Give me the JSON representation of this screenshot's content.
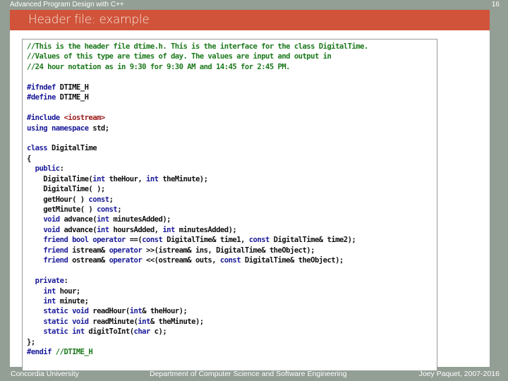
{
  "header": {
    "course_title": "Advanced Program Design with C++",
    "slide_number": "16",
    "slide_title": "Header file: example"
  },
  "colors": {
    "frame": "#939e95",
    "header_band": "#d0533a",
    "comment": "#1c7a1c",
    "keyword": "#1a1a9a",
    "string": "#9a1a1a"
  },
  "code": {
    "lines": [
      [
        {
          "t": "//This is the header file dtime.h. This is the interface for the class DigitalTime.",
          "c": "cm"
        }
      ],
      [
        {
          "t": "//Values of this type are times of day. The values are input and output in",
          "c": "cm"
        }
      ],
      [
        {
          "t": "//24 hour notation as in 9:30 for 9:30 AM and 14:45 for 2:45 PM.",
          "c": "cm"
        }
      ],
      [],
      [
        {
          "t": "#ifndef",
          "c": "pp"
        },
        {
          "t": " DTIME_H",
          "c": ""
        }
      ],
      [
        {
          "t": "#define",
          "c": "pp"
        },
        {
          "t": " DTIME_H",
          "c": ""
        }
      ],
      [],
      [
        {
          "t": "#include",
          "c": "pp"
        },
        {
          "t": " ",
          "c": ""
        },
        {
          "t": "<iostream>",
          "c": "st"
        }
      ],
      [
        {
          "t": "using",
          "c": "kw"
        },
        {
          "t": " ",
          "c": ""
        },
        {
          "t": "namespace",
          "c": "kw"
        },
        {
          "t": " std;",
          "c": ""
        }
      ],
      [],
      [
        {
          "t": "class",
          "c": "kw"
        },
        {
          "t": " DigitalTime",
          "c": ""
        }
      ],
      [
        {
          "t": "{",
          "c": ""
        }
      ],
      [
        {
          "t": "  ",
          "c": ""
        },
        {
          "t": "public",
          "c": "kw"
        },
        {
          "t": ":",
          "c": ""
        }
      ],
      [
        {
          "t": "    DigitalTime(",
          "c": ""
        },
        {
          "t": "int",
          "c": "kw"
        },
        {
          "t": " theHour, ",
          "c": ""
        },
        {
          "t": "int",
          "c": "kw"
        },
        {
          "t": " theMinute);",
          "c": ""
        }
      ],
      [
        {
          "t": "    DigitalTime( );",
          "c": ""
        }
      ],
      [
        {
          "t": "    getHour( ) ",
          "c": ""
        },
        {
          "t": "const",
          "c": "kw"
        },
        {
          "t": ";",
          "c": ""
        }
      ],
      [
        {
          "t": "    getMinute( ) ",
          "c": ""
        },
        {
          "t": "const",
          "c": "kw"
        },
        {
          "t": ";",
          "c": ""
        }
      ],
      [
        {
          "t": "    ",
          "c": ""
        },
        {
          "t": "void",
          "c": "kw"
        },
        {
          "t": " advance(",
          "c": ""
        },
        {
          "t": "int",
          "c": "kw"
        },
        {
          "t": " minutesAdded);",
          "c": ""
        }
      ],
      [
        {
          "t": "    ",
          "c": ""
        },
        {
          "t": "void",
          "c": "kw"
        },
        {
          "t": " advance(",
          "c": ""
        },
        {
          "t": "int",
          "c": "kw"
        },
        {
          "t": " hoursAdded, ",
          "c": ""
        },
        {
          "t": "int",
          "c": "kw"
        },
        {
          "t": " minutesAdded);",
          "c": ""
        }
      ],
      [
        {
          "t": "    ",
          "c": ""
        },
        {
          "t": "friend",
          "c": "kw"
        },
        {
          "t": " ",
          "c": ""
        },
        {
          "t": "bool",
          "c": "kw"
        },
        {
          "t": " ",
          "c": ""
        },
        {
          "t": "operator",
          "c": "kw"
        },
        {
          "t": " ==(",
          "c": ""
        },
        {
          "t": "const",
          "c": "kw"
        },
        {
          "t": " DigitalTime& time1, ",
          "c": ""
        },
        {
          "t": "const",
          "c": "kw"
        },
        {
          "t": " DigitalTime& time2);",
          "c": ""
        }
      ],
      [
        {
          "t": "    ",
          "c": ""
        },
        {
          "t": "friend",
          "c": "kw"
        },
        {
          "t": " istream& ",
          "c": ""
        },
        {
          "t": "operator",
          "c": "kw"
        },
        {
          "t": " >>(istream& ins, DigitalTime& theObject);",
          "c": ""
        }
      ],
      [
        {
          "t": "    ",
          "c": ""
        },
        {
          "t": "friend",
          "c": "kw"
        },
        {
          "t": " ostream& ",
          "c": ""
        },
        {
          "t": "operator",
          "c": "kw"
        },
        {
          "t": " <<(ostream& outs, ",
          "c": ""
        },
        {
          "t": "const",
          "c": "kw"
        },
        {
          "t": " DigitalTime& theObject);",
          "c": ""
        }
      ],
      [],
      [
        {
          "t": "  ",
          "c": ""
        },
        {
          "t": "private",
          "c": "kw"
        },
        {
          "t": ":",
          "c": ""
        }
      ],
      [
        {
          "t": "    ",
          "c": ""
        },
        {
          "t": "int",
          "c": "kw"
        },
        {
          "t": " hour;",
          "c": ""
        }
      ],
      [
        {
          "t": "    ",
          "c": ""
        },
        {
          "t": "int",
          "c": "kw"
        },
        {
          "t": " minute;",
          "c": ""
        }
      ],
      [
        {
          "t": "    ",
          "c": ""
        },
        {
          "t": "static",
          "c": "kw"
        },
        {
          "t": " ",
          "c": ""
        },
        {
          "t": "void",
          "c": "kw"
        },
        {
          "t": " readHour(",
          "c": ""
        },
        {
          "t": "int",
          "c": "kw"
        },
        {
          "t": "& theHour);",
          "c": ""
        }
      ],
      [
        {
          "t": "    ",
          "c": ""
        },
        {
          "t": "static",
          "c": "kw"
        },
        {
          "t": " ",
          "c": ""
        },
        {
          "t": "void",
          "c": "kw"
        },
        {
          "t": " readMinute(",
          "c": ""
        },
        {
          "t": "int",
          "c": "kw"
        },
        {
          "t": "& theMinute);",
          "c": ""
        }
      ],
      [
        {
          "t": "    ",
          "c": ""
        },
        {
          "t": "static",
          "c": "kw"
        },
        {
          "t": " ",
          "c": ""
        },
        {
          "t": "int",
          "c": "kw"
        },
        {
          "t": " digitToInt(",
          "c": ""
        },
        {
          "t": "char",
          "c": "kw"
        },
        {
          "t": " c);",
          "c": ""
        }
      ],
      [
        {
          "t": "};",
          "c": ""
        }
      ],
      [
        {
          "t": "#endif",
          "c": "pp"
        },
        {
          "t": " ",
          "c": ""
        },
        {
          "t": "//DTIME_H",
          "c": "cm"
        }
      ]
    ]
  },
  "footer": {
    "left": "Concordia University",
    "center": "Department of Computer Science and Software Engineering",
    "right": "Joey Paquet, 2007-2016"
  }
}
